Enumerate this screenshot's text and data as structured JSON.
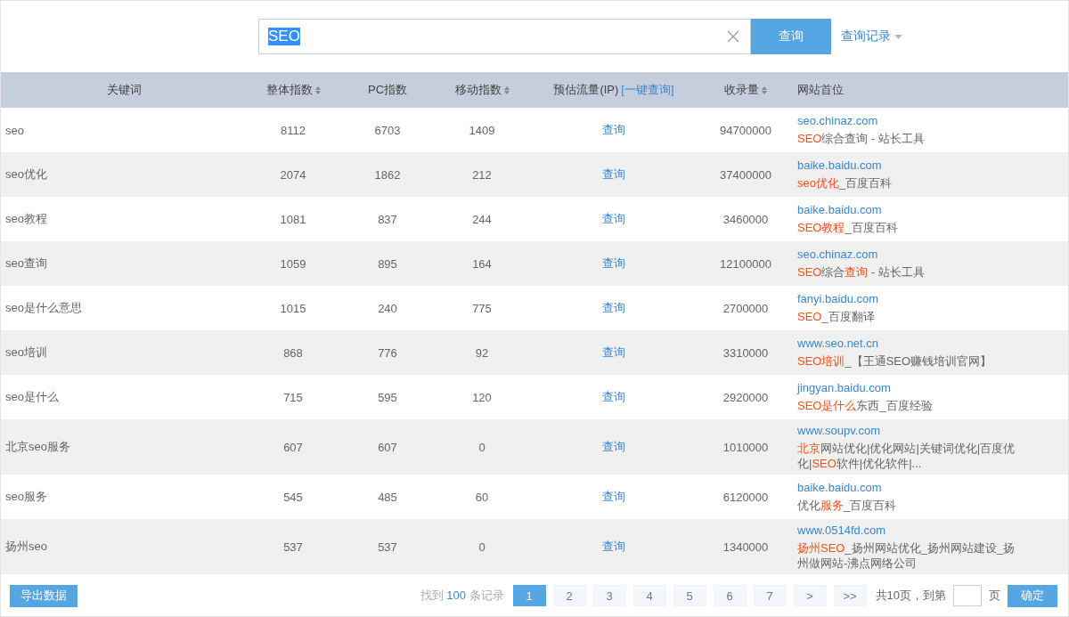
{
  "search": {
    "value": "SEO",
    "button": "查询",
    "history": "查询记录"
  },
  "table": {
    "columns": [
      {
        "label": "关键词",
        "sortable": false
      },
      {
        "label": "整体指数",
        "sortable": true
      },
      {
        "label": "PC指数",
        "sortable": false
      },
      {
        "label": "移动指数",
        "sortable": true
      },
      {
        "label": "预估流量(IP)",
        "link": "[一键查询]",
        "sortable": false
      },
      {
        "label": "收录量",
        "sortable": true
      },
      {
        "label": "网站首位",
        "sortable": false
      }
    ],
    "rows": [
      {
        "keyword": "seo",
        "total": "8112",
        "pc": "6703",
        "mobile": "1409",
        "traffic": "查询",
        "indexed": "94700000",
        "site": "seo.chinaz.com",
        "title": [
          {
            "text": "SEO",
            "hit": true
          },
          {
            "text": "综合查询 - 站长工具",
            "hit": false
          }
        ]
      },
      {
        "keyword": "seo优化",
        "total": "2074",
        "pc": "1862",
        "mobile": "212",
        "traffic": "查询",
        "indexed": "37400000",
        "site": "baike.baidu.com",
        "title": [
          {
            "text": "seo优化",
            "hit": true
          },
          {
            "text": "_百度百科",
            "hit": false
          }
        ]
      },
      {
        "keyword": "seo教程",
        "total": "1081",
        "pc": "837",
        "mobile": "244",
        "traffic": "查询",
        "indexed": "3460000",
        "site": "baike.baidu.com",
        "title": [
          {
            "text": "SEO教程",
            "hit": true
          },
          {
            "text": "_百度百科",
            "hit": false
          }
        ]
      },
      {
        "keyword": "seo查询",
        "total": "1059",
        "pc": "895",
        "mobile": "164",
        "traffic": "查询",
        "indexed": "12100000",
        "site": "seo.chinaz.com",
        "title": [
          {
            "text": "SEO",
            "hit": true
          },
          {
            "text": "综合",
            "hit": false
          },
          {
            "text": "查询",
            "hit": true
          },
          {
            "text": " - 站长工具",
            "hit": false
          }
        ]
      },
      {
        "keyword": "seo是什么意思",
        "total": "1015",
        "pc": "240",
        "mobile": "775",
        "traffic": "查询",
        "indexed": "2700000",
        "site": "fanyi.baidu.com",
        "title": [
          {
            "text": "SEO",
            "hit": true
          },
          {
            "text": "_百度翻译",
            "hit": false
          }
        ]
      },
      {
        "keyword": "seo培训",
        "total": "868",
        "pc": "776",
        "mobile": "92",
        "traffic": "查询",
        "indexed": "3310000",
        "site": "www.seo.net.cn",
        "title": [
          {
            "text": "SEO培训",
            "hit": true
          },
          {
            "text": "_【王通SEO赚钱培训官网】",
            "hit": false
          }
        ]
      },
      {
        "keyword": "seo是什么",
        "total": "715",
        "pc": "595",
        "mobile": "120",
        "traffic": "查询",
        "indexed": "2920000",
        "site": "jingyan.baidu.com",
        "title": [
          {
            "text": "SEO是什么",
            "hit": true
          },
          {
            "text": "东西_百度经验",
            "hit": false
          }
        ]
      },
      {
        "keyword": "北京seo服务",
        "total": "607",
        "pc": "607",
        "mobile": "0",
        "traffic": "查询",
        "indexed": "1010000",
        "site": "www.soupv.com",
        "title": [
          {
            "text": "北京",
            "hit": true
          },
          {
            "text": "网站优化|优化网站|关键词优化|百度优化|",
            "hit": false
          },
          {
            "text": "SEO",
            "hit": true
          },
          {
            "text": "软件|优化软件|...",
            "hit": false
          }
        ]
      },
      {
        "keyword": "seo服务",
        "total": "545",
        "pc": "485",
        "mobile": "60",
        "traffic": "查询",
        "indexed": "6120000",
        "site": "baike.baidu.com",
        "title": [
          {
            "text": "优化",
            "hit": false
          },
          {
            "text": "服务",
            "hit": true
          },
          {
            "text": "_百度百科",
            "hit": false
          }
        ]
      },
      {
        "keyword": "扬州seo",
        "total": "537",
        "pc": "537",
        "mobile": "0",
        "traffic": "查询",
        "indexed": "1340000",
        "site": "www.0514fd.com",
        "title": [
          {
            "text": "扬州SEO",
            "hit": true
          },
          {
            "text": "_扬州网站优化_扬州网站建设_扬州做网站-沸点网络公司",
            "hit": false
          }
        ]
      }
    ]
  },
  "footer": {
    "export": "导出数据",
    "found_prefix": "找到",
    "found_count": "100",
    "found_suffix": "条记录",
    "pages": [
      {
        "label": "1",
        "selected": true
      },
      {
        "label": "2",
        "selected": false
      },
      {
        "label": "3",
        "selected": false
      },
      {
        "label": "4",
        "selected": false
      },
      {
        "label": "5",
        "selected": false
      },
      {
        "label": "6",
        "selected": false
      },
      {
        "label": "7",
        "selected": false
      },
      {
        "label": ">",
        "selected": false
      },
      {
        "label": ">>",
        "selected": false
      }
    ],
    "total_text": "共10页，到第",
    "page_unit": "页",
    "confirm": "确定"
  }
}
